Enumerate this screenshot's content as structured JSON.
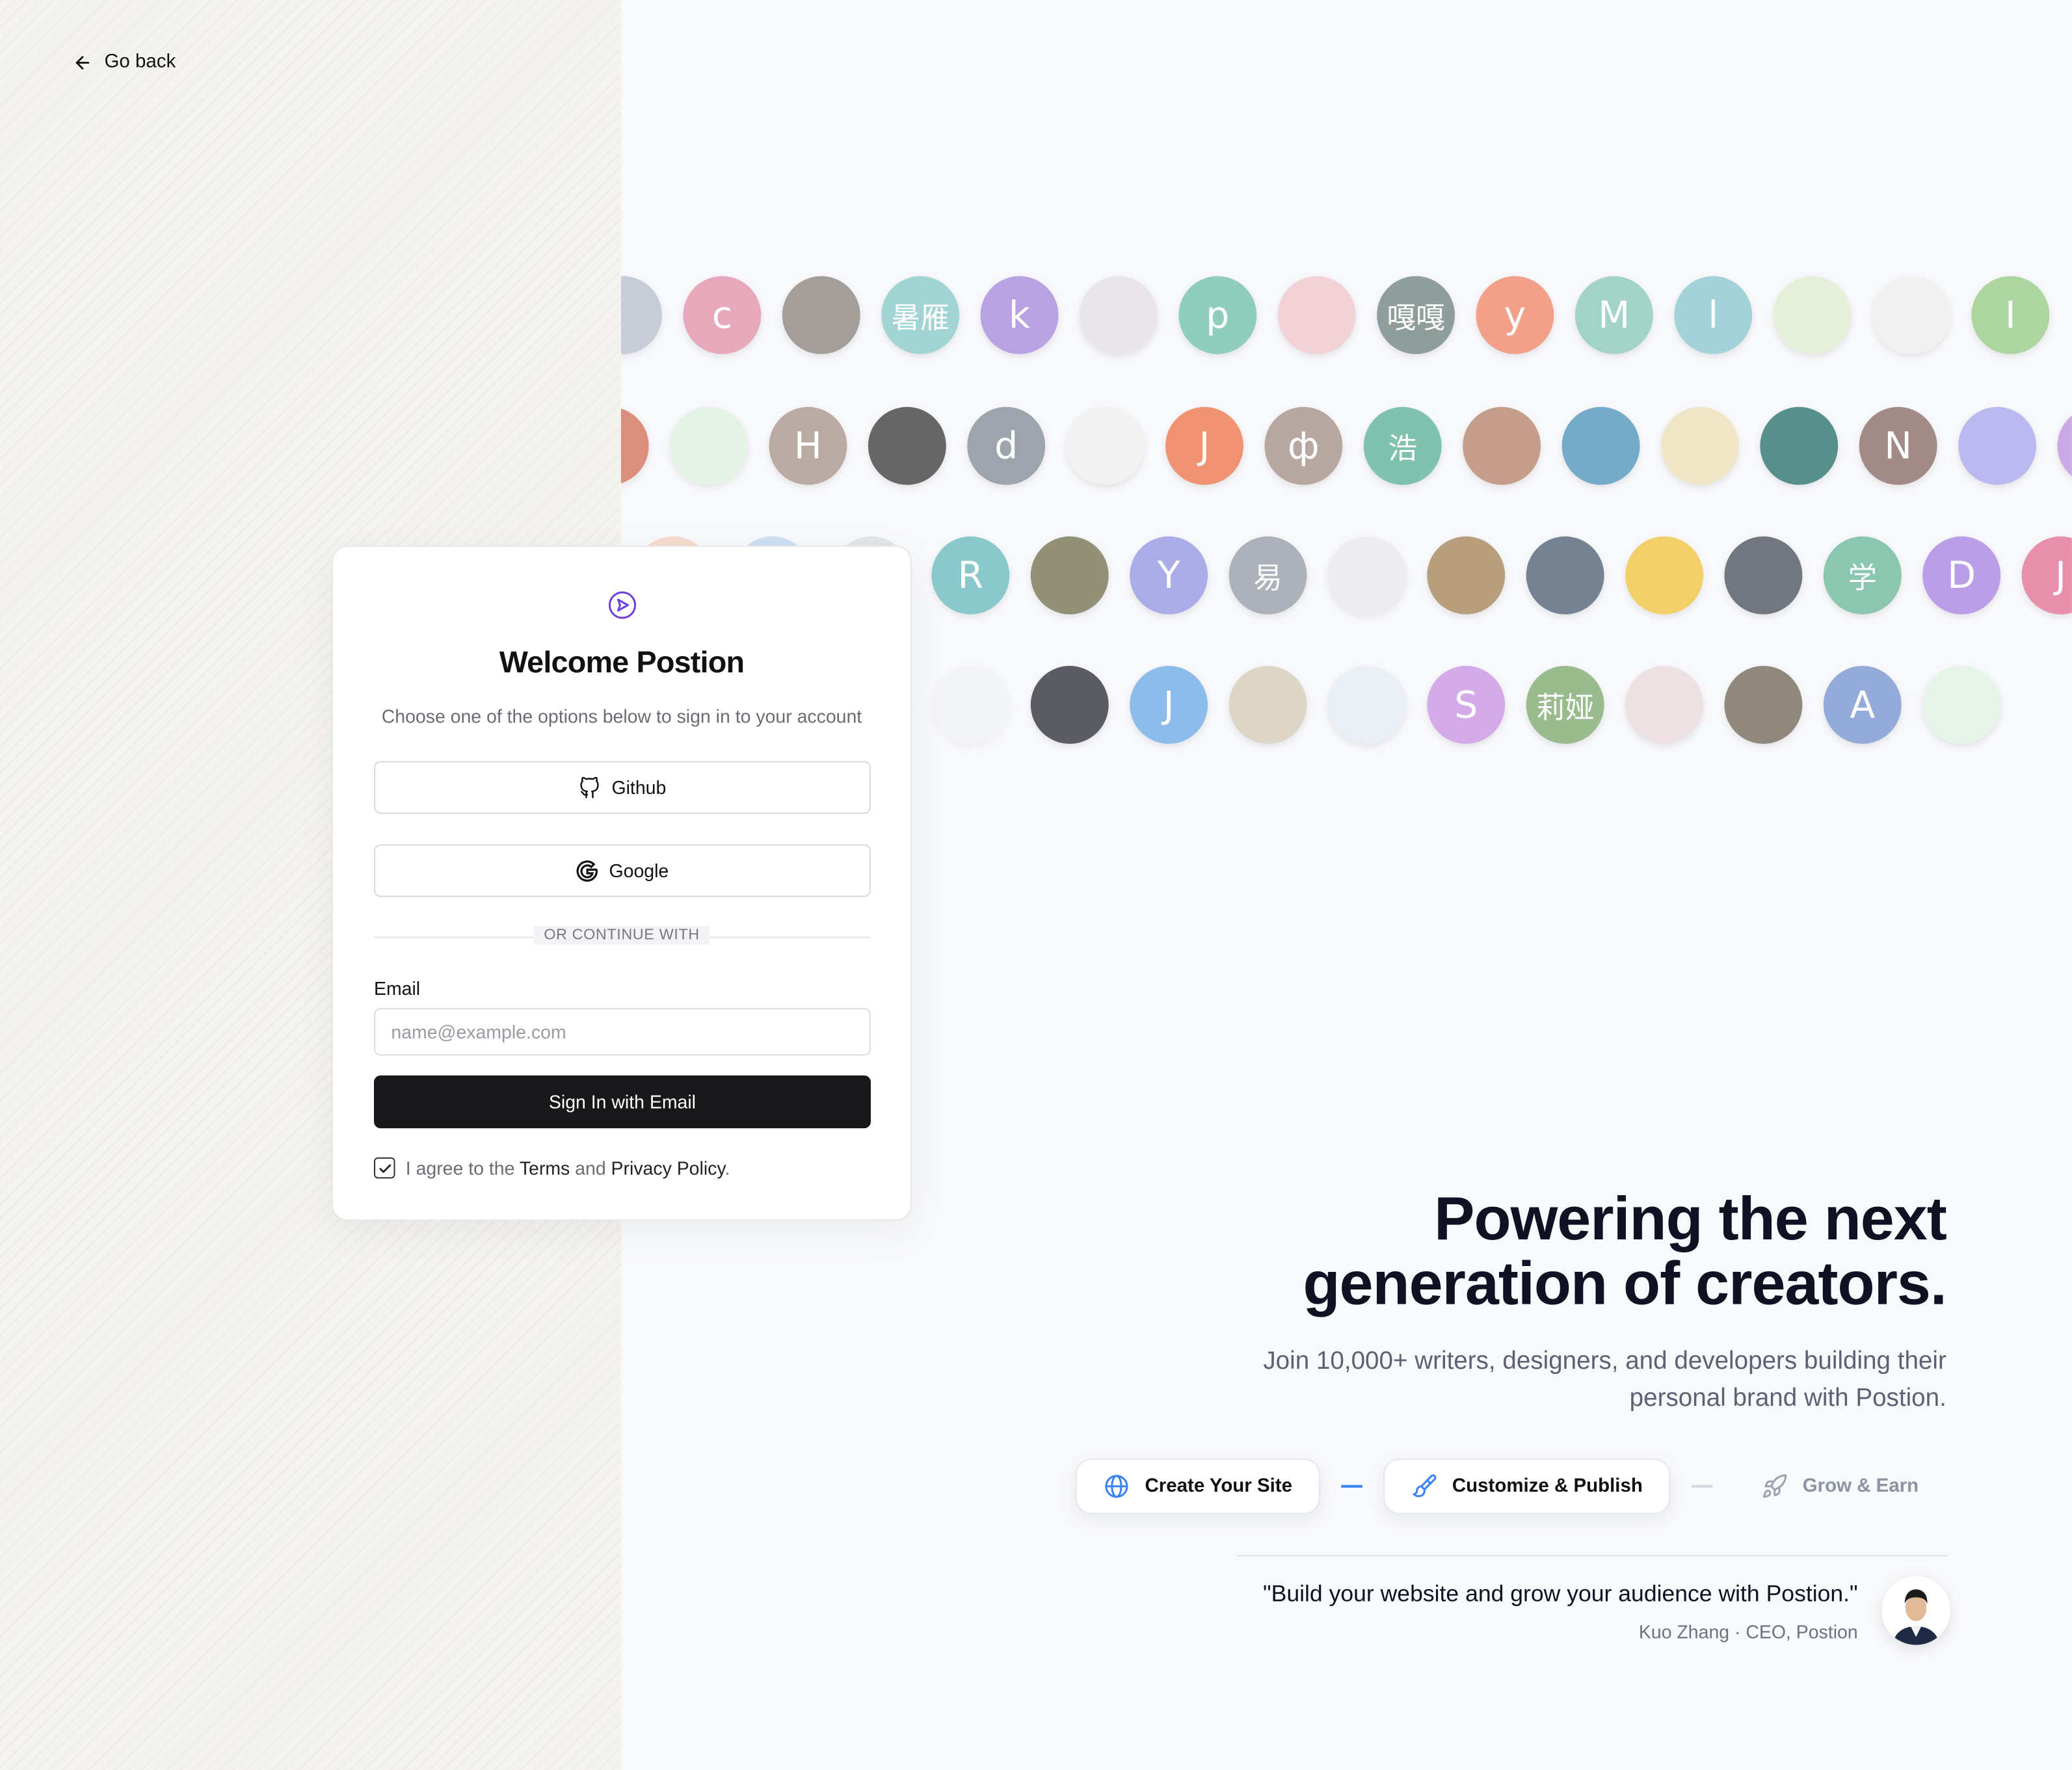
{
  "nav": {
    "go_back_label": "Go back",
    "go_back_icon": "arrow-left-icon"
  },
  "signin": {
    "logo_icon": "send-circle-icon",
    "title": "Welcome Postion",
    "subtitle": "Choose one of the options below to sign in to your account",
    "github_label": "Github",
    "google_label": "Google",
    "divider_label": "OR CONTINUE WITH",
    "email_label": "Email",
    "email_placeholder": "name@example.com",
    "email_value": "",
    "submit_label": "Sign In with Email",
    "agree_prefix": "I agree to the",
    "terms_label": "Terms",
    "agree_and": "and",
    "privacy_label": "Privacy Policy",
    "agree_suffix": ".",
    "agree_checked": true
  },
  "avatar_rows": [
    [
      "",
      "c",
      "",
      "暑雁",
      "k",
      "",
      "p",
      "",
      "嘎嘎",
      "y",
      "M",
      "l",
      "",
      "",
      "I"
    ],
    [
      "",
      "",
      "H",
      "",
      "d",
      "",
      "J",
      "ф",
      "浩",
      "",
      "",
      "",
      "",
      "N",
      "",
      ""
    ],
    [
      "X",
      "李淡",
      "",
      "R",
      "",
      "Y",
      "易",
      "",
      "",
      "",
      "",
      "",
      "学",
      "D",
      "J"
    ],
    [
      "",
      "",
      "",
      "",
      "",
      "J",
      "",
      "",
      "S",
      "莉娅",
      "",
      "",
      "A",
      ""
    ]
  ],
  "avatar_colors": [
    [
      "#b8bccb",
      "#e7a4b8",
      "#a09a96",
      "#9fd3d2",
      "#b69ee0",
      "#e8e6ea",
      "#8ccbb8",
      "#f2d0d6",
      "#8a9a96",
      "#f39c86",
      "#9fd0c4",
      "#9fd0d8",
      "#e6efd9",
      "#f1f1f1",
      "#a8d49c"
    ],
    [
      "#d9826e",
      "#e4f2e4",
      "#b7a6a0",
      "#5f5f5f",
      "#9aa0a8",
      "#f2f2f2",
      "#f08e6c",
      "#b3a39c",
      "#7bc0aa",
      "#c29a86",
      "#6fa7c7",
      "#efe5c6",
      "#4e8a86",
      "#9e8680",
      "#b8b6ef",
      "#c9a5e6"
    ],
    [
      "#f2a27c",
      "#8fbde8",
      "#c7cdd4",
      "#7ec4c8",
      "#8d8b70",
      "#a6a8e6",
      "#a9aeb7",
      "#ececee",
      "#b59a76",
      "#6d7c8c",
      "#f3cd62",
      "#6b7078",
      "#86c4ae",
      "#b79ae8",
      "#e88aa8"
    ],
    [
      "#c5c9d0",
      "#dfe2e6",
      "#b9b9d5",
      "#f0f0f2",
      "#53545b",
      "#86b9ea",
      "#dcd5c5",
      "#e9eef6",
      "#d3a6e8",
      "#96b888",
      "#eedfe2",
      "#8b8277",
      "#8fa6d8",
      "#e5f3e8"
    ]
  ],
  "hero": {
    "title_line1": "Powering the next",
    "title_line2": "generation of creators.",
    "subtitle": "Join 10,000+ writers, designers, and developers building their personal brand with Postion."
  },
  "steps": [
    {
      "label": "Create Your Site",
      "icon": "globe-icon",
      "state": "done"
    },
    {
      "label": "Customize & Publish",
      "icon": "paintbrush-icon",
      "state": "active"
    },
    {
      "label": "Grow & Earn",
      "icon": "rocket-icon",
      "state": "upcoming"
    }
  ],
  "testimonial": {
    "quote": "\"Build your website and grow your audience with Postion.\"",
    "author": "Kuo Zhang · CEO, Postion"
  },
  "colors": {
    "accent": "#3b82f6",
    "logo": "#6d3fe0",
    "primary_button": "#18181b",
    "hero_text": "#0f1222"
  }
}
